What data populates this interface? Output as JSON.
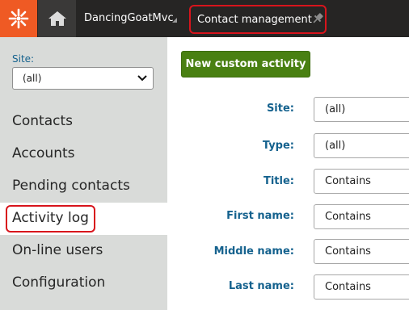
{
  "header": {
    "logo_icon": "kentico-logo-icon",
    "home_icon": "home-icon",
    "site_name": "DancingGoatMvc",
    "application": "Contact management",
    "pin_icon": "pin-icon",
    "brand_color": "#ef5a24"
  },
  "sidebar": {
    "site_label": "Site:",
    "site_value": "(all)",
    "items": [
      {
        "label": "Contacts"
      },
      {
        "label": "Accounts"
      },
      {
        "label": "Pending contacts"
      },
      {
        "label": "Activity log"
      },
      {
        "label": "On-line users"
      },
      {
        "label": "Configuration"
      }
    ],
    "active_item": "Activity log"
  },
  "main": {
    "new_button": "New custom activity",
    "filters": [
      {
        "label": "Site:",
        "value": "(all)"
      },
      {
        "label": "Type:",
        "value": "(all)"
      },
      {
        "label": "Title:",
        "value": "Contains"
      },
      {
        "label": "First name:",
        "value": "Contains"
      },
      {
        "label": "Middle name:",
        "value": "Contains"
      },
      {
        "label": "Last name:",
        "value": "Contains"
      }
    ]
  }
}
